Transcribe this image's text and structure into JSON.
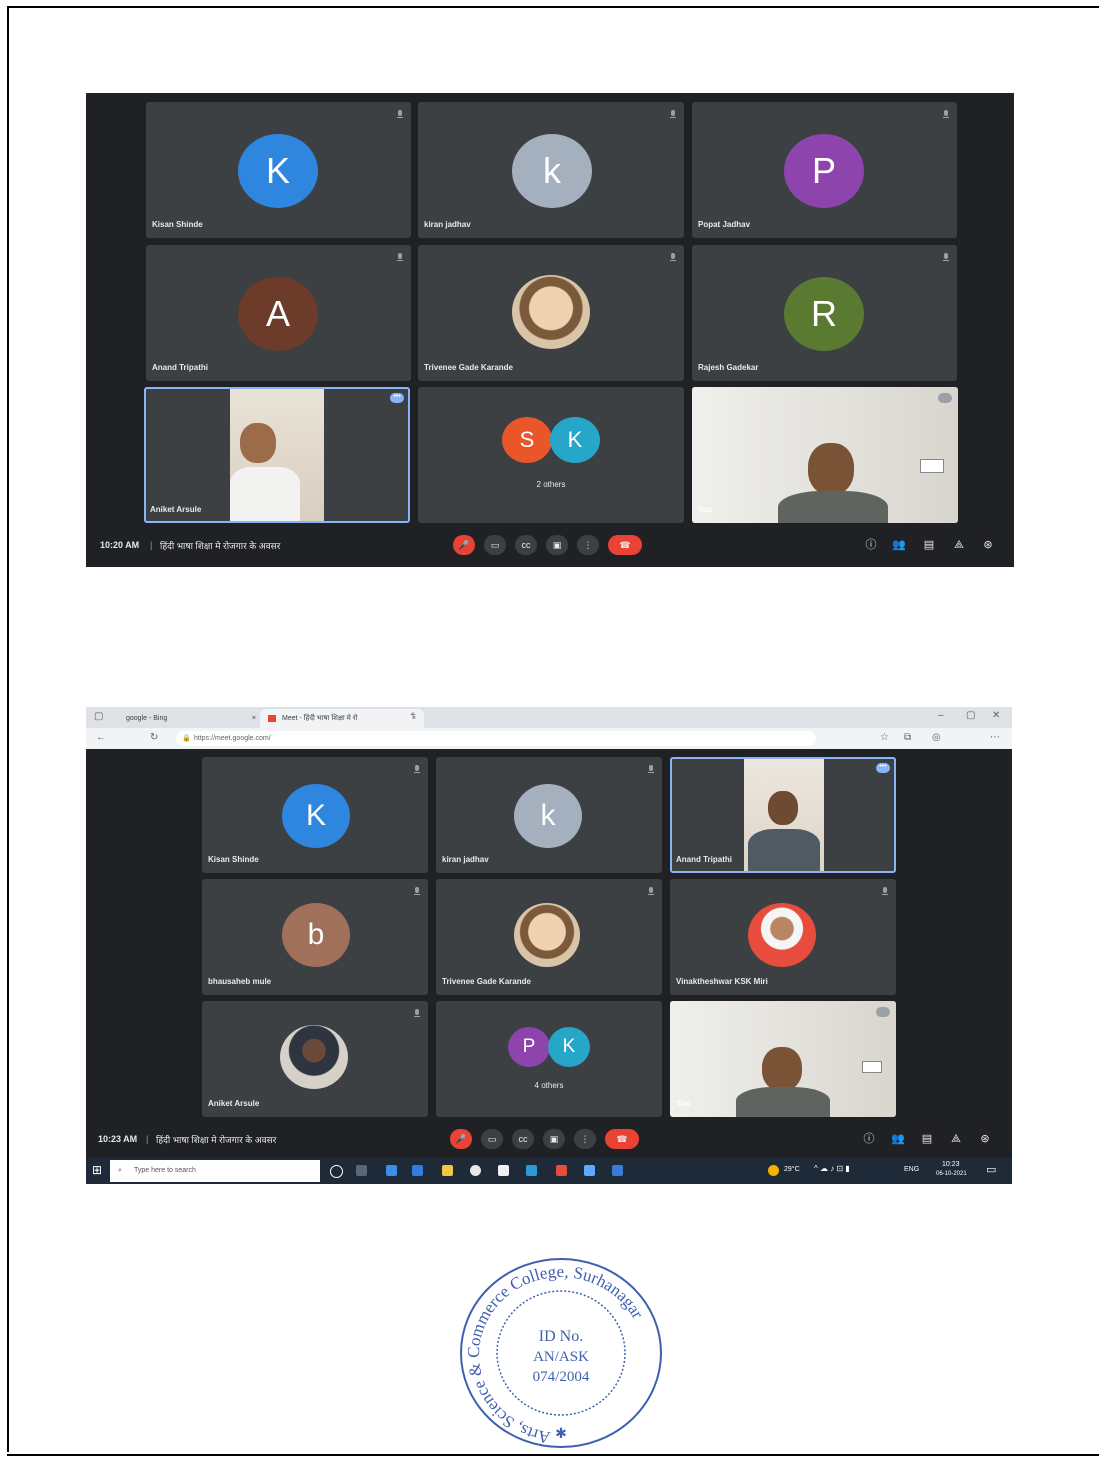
{
  "screen1": {
    "tiles": [
      {
        "name": "Kisan Shinde",
        "initial": "K",
        "color": "#2e86de"
      },
      {
        "name": "kiran jadhav",
        "initial": "k",
        "color": "#a4b0be"
      },
      {
        "name": "Popat Jadhav",
        "initial": "P",
        "color": "#8e44ad"
      },
      {
        "name": "Anand Tripathi",
        "initial": "A",
        "color": "#6d3b2a"
      },
      {
        "name": "Trivenee Gade Karande",
        "initial": "",
        "color": "#c9a27a"
      },
      {
        "name": "Rajesh Gadekar",
        "initial": "R",
        "color": "#5a7a32"
      },
      {
        "name": "Aniket Arsule",
        "initial": "",
        "color": ""
      },
      {
        "name": "2 others",
        "initial": "",
        "color": ""
      },
      {
        "name": "You",
        "initial": "",
        "color": ""
      }
    ],
    "others_avatars": [
      {
        "letter": "S",
        "color": "#e8562a"
      },
      {
        "letter": "K",
        "color": "#26a6c9"
      }
    ],
    "clock": "10:20 AM",
    "meeting_title": "हिंदी भाषा शिक्षा मे रोजगार के अवसर"
  },
  "screen2": {
    "browser": {
      "tab1_label": "google - Bing",
      "tab2_label": "Meet - हिंदी भाषा शिक्षा मे रो",
      "url": "https://meet.google.com/",
      "new_tab": "+"
    },
    "tiles": [
      {
        "name": "Kisan Shinde",
        "initial": "K",
        "color": "#2e86de"
      },
      {
        "name": "kiran jadhav",
        "initial": "k",
        "color": "#a4b0be"
      },
      {
        "name": "Anand Tripathi",
        "initial": "",
        "color": ""
      },
      {
        "name": "bhausaheb mule",
        "initial": "b",
        "color": "#a0705a"
      },
      {
        "name": "Trivenee Gade Karande",
        "initial": "",
        "color": "#c9a27a"
      },
      {
        "name": "Vinaktheshwar KSK Miri",
        "initial": "",
        "color": "#e74c3c"
      },
      {
        "name": "Aniket Arsule",
        "initial": "",
        "color": ""
      },
      {
        "name": "4 others",
        "initial": "",
        "color": ""
      },
      {
        "name": "You",
        "initial": "",
        "color": ""
      }
    ],
    "others_avatars": [
      {
        "letter": "P",
        "color": "#8e44ad"
      },
      {
        "letter": "K",
        "color": "#26a6c9"
      }
    ],
    "clock": "10:23 AM",
    "meeting_title": "हिंदी भाषा शिक्षा मे रोजगार के अवसर",
    "taskbar": {
      "search_placeholder": "Type here to search",
      "weather": "29°C",
      "language": "ENG",
      "time": "10:23",
      "date": "06-10-2021"
    }
  },
  "stamp": {
    "line1": "ID No.",
    "line2": "AN/ASK",
    "line3": "074/2004",
    "ring_text": "Arts, Science & Commerce College, Surhanagar"
  }
}
